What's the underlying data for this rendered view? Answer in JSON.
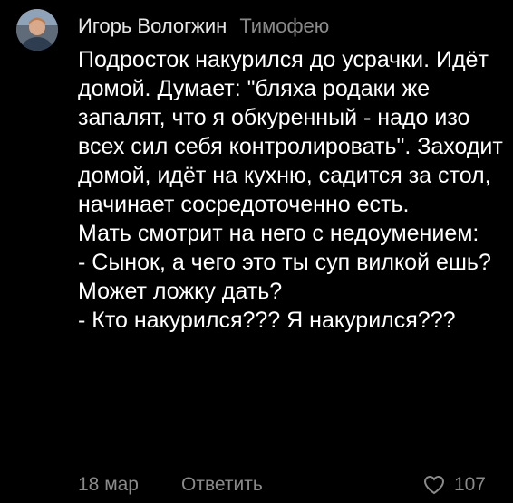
{
  "comment": {
    "author": "Игорь Вологжин",
    "reply_to": "Тимофею",
    "body": [
      "Подросток накурился до усрачки. Идёт домой. Думает: \"бляха родаки же запалят, что я обкуренный - надо изо всех сил себя контролировать\". Заходит домой, идёт на кухню, садится за стол, начинает сосредоточенно есть.",
      "Мать смотрит на него с недоумением:",
      "- Сынок, а чего это ты суп вилкой ешь? Может ложку дать?",
      "- Кто накурился??? Я накурился???"
    ],
    "date": "18 мар",
    "reply_label": "Ответить",
    "likes": "107",
    "icons": {
      "avatar": "avatar-photo",
      "like": "heart-outline-icon"
    },
    "colors": {
      "background": "#000000",
      "text": "#ffffff",
      "muted": "#8a8a8a"
    }
  }
}
